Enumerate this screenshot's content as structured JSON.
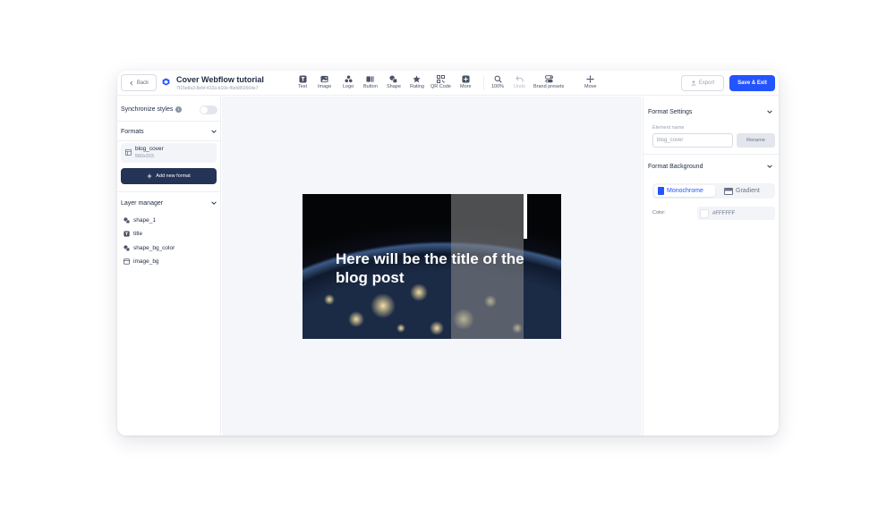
{
  "toolbar": {
    "back_label": "Back",
    "doc_title": "Cover Webflow tutorial",
    "doc_id": "7f15e8a3-8ebf-432a-b10e-f6eb850664e7",
    "tools": [
      {
        "label": "Text",
        "icon": "text-icon"
      },
      {
        "label": "Image",
        "icon": "image-icon"
      },
      {
        "label": "Logo",
        "icon": "logo-icon"
      },
      {
        "label": "Button",
        "icon": "button-icon"
      },
      {
        "label": "Shape",
        "icon": "shape-icon"
      },
      {
        "label": "Rating",
        "icon": "star-icon"
      },
      {
        "label": "QR Code",
        "icon": "qr-code-icon"
      },
      {
        "label": "More",
        "icon": "plus-icon"
      },
      {
        "label": "100%",
        "icon": "zoom-icon"
      },
      {
        "label": "Undo",
        "icon": "undo-icon"
      },
      {
        "label": "Brand presets",
        "icon": "brand-presets-icon"
      },
      {
        "label": "Move",
        "icon": "move-icon"
      }
    ],
    "export_label": "Export",
    "save_label": "Save & Exit"
  },
  "left_panel": {
    "sync_label": "Synchronize styles",
    "sync_enabled": false,
    "formats_title": "Formats",
    "format": {
      "name": "blog_cover",
      "size": "560x315"
    },
    "add_format_label": "Add new format",
    "layer_manager_title": "Layer manager",
    "layers": [
      "shape_1",
      "title",
      "shape_bg_color",
      "image_bg"
    ]
  },
  "canvas": {
    "title_text": "Here will be the title of the blog post"
  },
  "right_panel": {
    "format_settings_title": "Format Settings",
    "element_name_label": "Element name",
    "element_name_value": "blog_cover",
    "rename_label": "Rename",
    "format_background_title": "Format Background",
    "mode_monochrome": "Monochrome",
    "mode_gradient": "Gradient",
    "color_label": "Color:",
    "color_value": "#FFFFFF"
  },
  "colors": {
    "accent": "#2354ff",
    "dark_button": "#243356",
    "canvas_bg": "#f4f6fa"
  }
}
